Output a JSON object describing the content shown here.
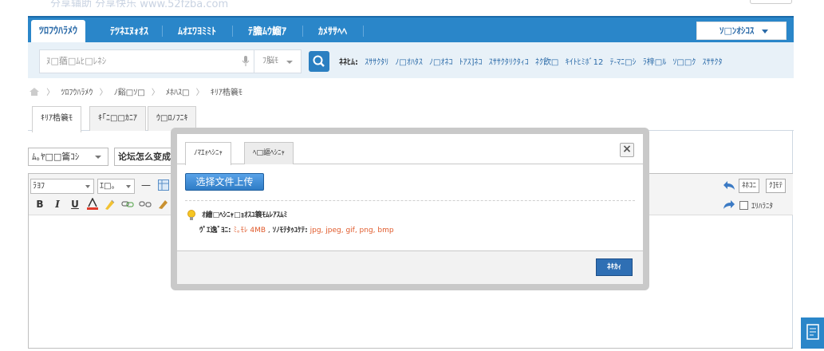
{
  "site": {
    "banner_text": "分享辅助 分享快乐 www.52fzba.com"
  },
  "nav": {
    "tabs": [
      {
        "label": "ﾂﾛﾌｳﾊﾗﾒｳ",
        "active": true
      },
      {
        "label": "ﾃﾂﾈｴﾇｫｵｽ",
        "active": false
      },
      {
        "label": "ﾑｵｴﾜﾖﾐﾐﾄ",
        "active": false
      },
      {
        "label": "ﾃ膽ﾑｳ鰡ｱ",
        "active": false
      },
      {
        "label": "ｶﾒｻｻﾍﾍ",
        "active": false
      }
    ],
    "dropdown_label": "ｿ□ﾝｵｼｺｽ"
  },
  "search": {
    "placeholder": "ﾇ□蕕□ﾑﾋ□ﾚﾈｼ",
    "type_label": "ﾌ脳ﾓ",
    "hot_label": "ﾈﾈﾋﾑ:",
    "hot_terms": [
      "ｽｻｻｸﾀﾘ",
      "ﾉ□ｵﾊﾀｽ",
      "ﾉ□ｵﾈｺ",
      "ﾄｱｽ]ﾈｺ",
      "ｽｻｻｸﾀﾘｸﾀｨｺ",
      "ﾈｸ飮□",
      "ｷｲﾄﾋﾐﾎﾞ12",
      "ﾃ-ﾏﾆ□ｼ",
      "ﾗ梓□ﾙ",
      "ｿ□□ｸ",
      "ｽｻｻｸﾀ"
    ]
  },
  "breadcrumb": {
    "items": [
      "ﾂﾛﾌｳﾊﾗﾒｳ",
      "ﾉ谿□ｿ□",
      "ﾒﾎﾊｽ□",
      "ｷﾘｱ梏簔ﾓ"
    ]
  },
  "content_tabs": [
    {
      "label": "ｷﾘｱ梏簔ﾓ",
      "active": true
    },
    {
      "label": "ｷ｢ﾆ□□ｶﾆｱ",
      "active": false
    },
    {
      "label": "ｳ□ﾛﾉﾌﾆｷ",
      "active": false
    }
  ],
  "form": {
    "category_select": "ﾑ｡ﾔ□□籥ｺｼ",
    "title_input": "论坛怎么变成"
  },
  "editor": {
    "font_family": "ﾗﾖﾌ",
    "font_size": "ｴ□。",
    "right_buttons": [
      "ﾈﾎｺﾆ",
      "ｸ]ﾓﾃ"
    ],
    "checkbox_label": "ｴﾘﾊﾗﾆﾀ"
  },
  "modal": {
    "tabs": [
      {
        "label": "ﾉﾏｴｫﾍｼﾆｬ",
        "active": true
      },
      {
        "label": "ﾍ□謳ﾍｼﾆｬ",
        "active": false
      }
    ],
    "close_glyph": "×",
    "upload_button": "选择文件上传",
    "tip_line1": "ｵ繪□ﾍｼﾆｬ□ｮｵｽﾕ簔ﾓﾑﾚｱｽﾑﾐ",
    "tip_label_size": "ｳﾟｴ逸ﾞﾖﾆ:",
    "tip_size": "ﾐ｡ﾓﾚ 4MB",
    "tip_label_types": "ｿﾉﾓﾃﾀｩﾕｹﾃ:",
    "tip_types": "jpg, jpeg, gif, png, bmp",
    "ok_button": "ﾈｷｶｨ"
  },
  "colors": {
    "nav_blue": "#2a86c9",
    "link_blue": "#2a6aa8",
    "tip_red": "#e05a2b",
    "upload_blue": "#2f7cc6"
  }
}
